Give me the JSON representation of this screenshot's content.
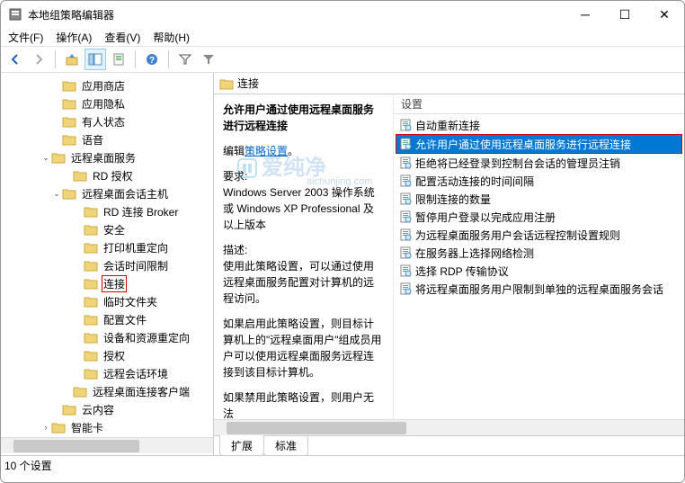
{
  "window": {
    "title": "本地组策略编辑器"
  },
  "menu": {
    "file": "文件(F)",
    "action": "操作(A)",
    "view": "查看(V)",
    "help": "帮助(H)"
  },
  "tree": {
    "items": [
      {
        "indent": 56,
        "expand": "",
        "label": "应用商店"
      },
      {
        "indent": 56,
        "expand": "",
        "label": "应用隐私"
      },
      {
        "indent": 56,
        "expand": "",
        "label": "有人状态"
      },
      {
        "indent": 56,
        "expand": "",
        "label": "语音"
      },
      {
        "indent": 44,
        "expand": "v",
        "label": "远程桌面服务"
      },
      {
        "indent": 68,
        "expand": "",
        "label": "RD 授权"
      },
      {
        "indent": 56,
        "expand": "v",
        "label": "远程桌面会话主机"
      },
      {
        "indent": 80,
        "expand": "",
        "label": "RD 连接 Broker"
      },
      {
        "indent": 80,
        "expand": "",
        "label": "安全"
      },
      {
        "indent": 80,
        "expand": "",
        "label": "打印机重定向"
      },
      {
        "indent": 80,
        "expand": "",
        "label": "会话时间限制"
      },
      {
        "indent": 80,
        "expand": "",
        "label": "连接",
        "highlighted": true
      },
      {
        "indent": 80,
        "expand": "",
        "label": "临时文件夹"
      },
      {
        "indent": 80,
        "expand": "",
        "label": "配置文件"
      },
      {
        "indent": 80,
        "expand": "",
        "label": "设备和资源重定向"
      },
      {
        "indent": 80,
        "expand": "",
        "label": "授权"
      },
      {
        "indent": 80,
        "expand": "",
        "label": "远程会话环境"
      },
      {
        "indent": 68,
        "expand": "",
        "label": "远程桌面连接客户端"
      },
      {
        "indent": 56,
        "expand": "",
        "label": "云内容"
      },
      {
        "indent": 44,
        "expand": ">",
        "label": "智能卡"
      }
    ]
  },
  "rightHeader": "连接",
  "detail": {
    "title": "允许用户通过使用远程桌面服务进行远程连接",
    "editPrefix": "编辑",
    "editLink": "策略设置",
    "reqLabel": "要求:",
    "reqText": "Windows Server 2003 操作系统或 Windows XP Professional 及以上版本",
    "descLabel": "描述:",
    "desc1": "使用此策略设置，可以通过使用远程桌面服务配置对计算机的远程访问。",
    "desc2": "如果启用此策略设置，则目标计算机上的\"远程桌面用户\"组成员用户可以使用远程桌面服务远程连接到该目标计算机。",
    "desc3": "如果禁用此策略设置，则用户无法"
  },
  "listHeader": "设置",
  "settings": [
    "自动重新连接",
    "允许用户通过使用远程桌面服务进行远程连接",
    "拒绝将已经登录到控制台会话的管理员注销",
    "配置活动连接的时间间隔",
    "限制连接的数量",
    "暂停用户登录以完成应用注册",
    "为远程桌面服务用户会话远程控制设置规则",
    "在服务器上选择网络检测",
    "选择 RDP 传输协议",
    "将远程桌面服务用户限制到单独的远程桌面服务会话"
  ],
  "selectedIndex": 1,
  "tabs": {
    "extended": "扩展",
    "standard": "标准"
  },
  "status": "10 个设置",
  "watermark": "爱纯净",
  "watermarkSub": "aichunjing.com"
}
